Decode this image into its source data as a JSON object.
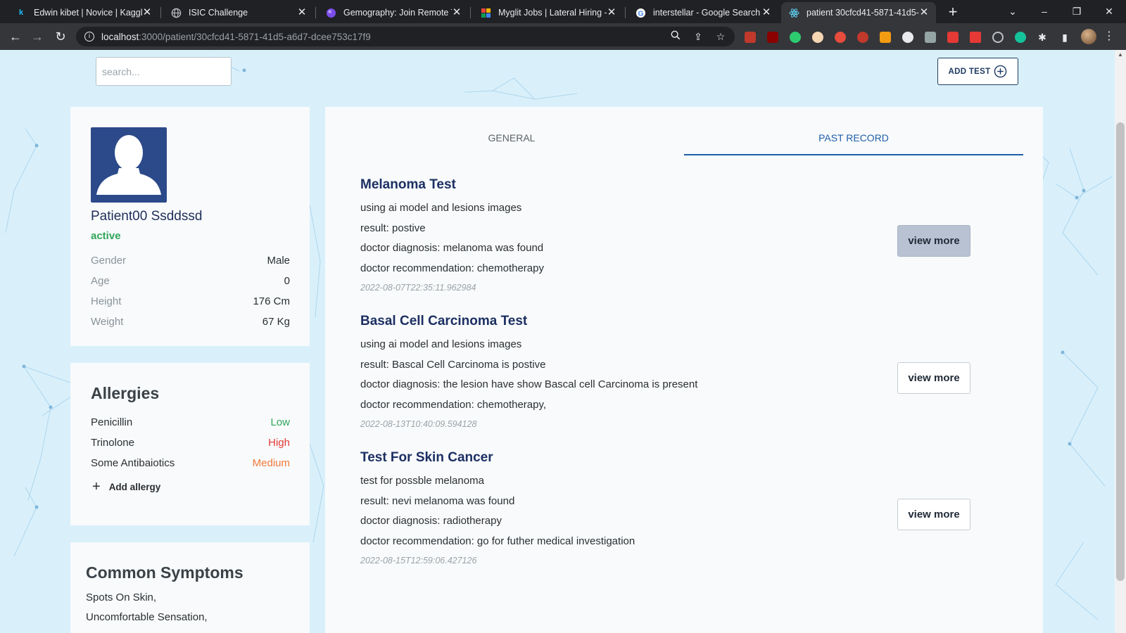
{
  "browser": {
    "tabs": [
      {
        "title": "Edwin kibet | Novice | Kaggle",
        "icon": "kaggle-icon",
        "color": "#20beff"
      },
      {
        "title": "ISIC Challenge",
        "icon": "globe-icon",
        "color": "#9aa0a6"
      },
      {
        "title": "Gemography: Join Remote Te",
        "icon": "gemography-icon",
        "color": "#7b4de8"
      },
      {
        "title": "Myglit Jobs | Lateral Hiring - I",
        "icon": "myglit-icon",
        "color": "#e8453c"
      },
      {
        "title": "interstellar - Google Search",
        "icon": "google-icon",
        "color": "#4285f4"
      },
      {
        "title": "patient 30cfcd41-5871-41d5-",
        "icon": "react-icon",
        "color": "#61dafb"
      }
    ],
    "active_tab_index": 5,
    "url_host": "localhost",
    "url_rest": ":3000/patient/30cfcd41-5871-41d5-a6d7-dcee753c17f9"
  },
  "search": {
    "placeholder": "search..."
  },
  "add_test_label": "ADD TEST",
  "patient": {
    "name": "Patient00 Ssddssd",
    "status": "active",
    "details": [
      {
        "label": "Gender",
        "value": "Male"
      },
      {
        "label": "Age",
        "value": "0"
      },
      {
        "label": "Height",
        "value": "176 Cm"
      },
      {
        "label": "Weight",
        "value": "67 Kg"
      }
    ]
  },
  "allergies": {
    "heading": "Allergies",
    "items": [
      {
        "name": "Penicillin",
        "level": "Low",
        "color": "#2fa65a"
      },
      {
        "name": "Trinolone",
        "level": "High",
        "color": "#e53935"
      },
      {
        "name": "Some Antibaiotics",
        "level": "Medium",
        "color": "#f07a3a"
      }
    ],
    "add_label": "Add allergy"
  },
  "symptoms": {
    "heading": "Common Symptoms",
    "items": [
      "Spots On Skin,",
      "Uncomfortable Sensation,"
    ]
  },
  "records_tabs": {
    "general": "GENERAL",
    "past": "PAST RECORD",
    "active": "past"
  },
  "records": [
    {
      "title": "Melanoma Test",
      "lines": [
        "using ai model and lesions images",
        "result: postive",
        "doctor diagnosis: melanoma was found",
        "doctor recommendation: chemotherapy"
      ],
      "date": "2022-08-07T22:35:11.962984",
      "button": "view more",
      "hover": true
    },
    {
      "title": "Basal Cell Carcinoma Test",
      "lines": [
        "using ai model and lesions images",
        "result: Bascal Cell Carcinoma is postive",
        "doctor diagnosis: the lesion have show Bascal cell Carcinoma is present",
        "doctor recommendation: chemotherapy,"
      ],
      "date": "2022-08-13T10:40:09.594128",
      "button": "view more",
      "hover": false
    },
    {
      "title": "Test For Skin Cancer",
      "lines": [
        "test for possble melanoma",
        "result: nevi melanoma was found",
        "doctor diagnosis: radiotherapy",
        "doctor recommendation: go for futher medical investigation"
      ],
      "date": "2022-08-15T12:59:06.427126",
      "button": "view more",
      "hover": false
    }
  ],
  "colors": {
    "accent": "#1f5fa8",
    "title_navy": "#1c2f63",
    "avatar_bg": "#2c4a8a",
    "page_bg": "#d9f0fb"
  }
}
